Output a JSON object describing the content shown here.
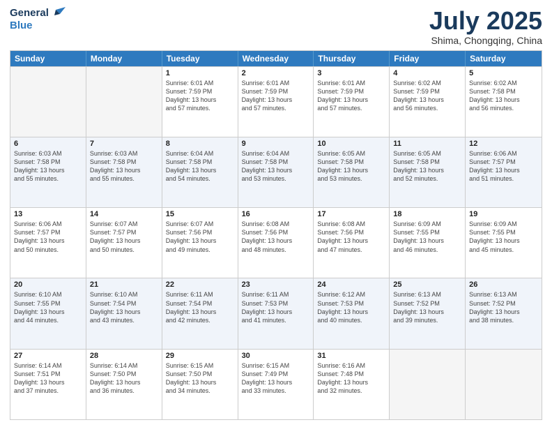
{
  "logo": {
    "line1": "General",
    "line2": "Blue"
  },
  "title": "July 2025",
  "subtitle": "Shima, Chongqing, China",
  "header_days": [
    "Sunday",
    "Monday",
    "Tuesday",
    "Wednesday",
    "Thursday",
    "Friday",
    "Saturday"
  ],
  "rows": [
    [
      {
        "day": "",
        "info": ""
      },
      {
        "day": "",
        "info": ""
      },
      {
        "day": "1",
        "info": "Sunrise: 6:01 AM\nSunset: 7:59 PM\nDaylight: 13 hours\nand 57 minutes."
      },
      {
        "day": "2",
        "info": "Sunrise: 6:01 AM\nSunset: 7:59 PM\nDaylight: 13 hours\nand 57 minutes."
      },
      {
        "day": "3",
        "info": "Sunrise: 6:01 AM\nSunset: 7:59 PM\nDaylight: 13 hours\nand 57 minutes."
      },
      {
        "day": "4",
        "info": "Sunrise: 6:02 AM\nSunset: 7:59 PM\nDaylight: 13 hours\nand 56 minutes."
      },
      {
        "day": "5",
        "info": "Sunrise: 6:02 AM\nSunset: 7:58 PM\nDaylight: 13 hours\nand 56 minutes."
      }
    ],
    [
      {
        "day": "6",
        "info": "Sunrise: 6:03 AM\nSunset: 7:58 PM\nDaylight: 13 hours\nand 55 minutes."
      },
      {
        "day": "7",
        "info": "Sunrise: 6:03 AM\nSunset: 7:58 PM\nDaylight: 13 hours\nand 55 minutes."
      },
      {
        "day": "8",
        "info": "Sunrise: 6:04 AM\nSunset: 7:58 PM\nDaylight: 13 hours\nand 54 minutes."
      },
      {
        "day": "9",
        "info": "Sunrise: 6:04 AM\nSunset: 7:58 PM\nDaylight: 13 hours\nand 53 minutes."
      },
      {
        "day": "10",
        "info": "Sunrise: 6:05 AM\nSunset: 7:58 PM\nDaylight: 13 hours\nand 53 minutes."
      },
      {
        "day": "11",
        "info": "Sunrise: 6:05 AM\nSunset: 7:58 PM\nDaylight: 13 hours\nand 52 minutes."
      },
      {
        "day": "12",
        "info": "Sunrise: 6:06 AM\nSunset: 7:57 PM\nDaylight: 13 hours\nand 51 minutes."
      }
    ],
    [
      {
        "day": "13",
        "info": "Sunrise: 6:06 AM\nSunset: 7:57 PM\nDaylight: 13 hours\nand 50 minutes."
      },
      {
        "day": "14",
        "info": "Sunrise: 6:07 AM\nSunset: 7:57 PM\nDaylight: 13 hours\nand 50 minutes."
      },
      {
        "day": "15",
        "info": "Sunrise: 6:07 AM\nSunset: 7:56 PM\nDaylight: 13 hours\nand 49 minutes."
      },
      {
        "day": "16",
        "info": "Sunrise: 6:08 AM\nSunset: 7:56 PM\nDaylight: 13 hours\nand 48 minutes."
      },
      {
        "day": "17",
        "info": "Sunrise: 6:08 AM\nSunset: 7:56 PM\nDaylight: 13 hours\nand 47 minutes."
      },
      {
        "day": "18",
        "info": "Sunrise: 6:09 AM\nSunset: 7:55 PM\nDaylight: 13 hours\nand 46 minutes."
      },
      {
        "day": "19",
        "info": "Sunrise: 6:09 AM\nSunset: 7:55 PM\nDaylight: 13 hours\nand 45 minutes."
      }
    ],
    [
      {
        "day": "20",
        "info": "Sunrise: 6:10 AM\nSunset: 7:55 PM\nDaylight: 13 hours\nand 44 minutes."
      },
      {
        "day": "21",
        "info": "Sunrise: 6:10 AM\nSunset: 7:54 PM\nDaylight: 13 hours\nand 43 minutes."
      },
      {
        "day": "22",
        "info": "Sunrise: 6:11 AM\nSunset: 7:54 PM\nDaylight: 13 hours\nand 42 minutes."
      },
      {
        "day": "23",
        "info": "Sunrise: 6:11 AM\nSunset: 7:53 PM\nDaylight: 13 hours\nand 41 minutes."
      },
      {
        "day": "24",
        "info": "Sunrise: 6:12 AM\nSunset: 7:53 PM\nDaylight: 13 hours\nand 40 minutes."
      },
      {
        "day": "25",
        "info": "Sunrise: 6:13 AM\nSunset: 7:52 PM\nDaylight: 13 hours\nand 39 minutes."
      },
      {
        "day": "26",
        "info": "Sunrise: 6:13 AM\nSunset: 7:52 PM\nDaylight: 13 hours\nand 38 minutes."
      }
    ],
    [
      {
        "day": "27",
        "info": "Sunrise: 6:14 AM\nSunset: 7:51 PM\nDaylight: 13 hours\nand 37 minutes."
      },
      {
        "day": "28",
        "info": "Sunrise: 6:14 AM\nSunset: 7:50 PM\nDaylight: 13 hours\nand 36 minutes."
      },
      {
        "day": "29",
        "info": "Sunrise: 6:15 AM\nSunset: 7:50 PM\nDaylight: 13 hours\nand 34 minutes."
      },
      {
        "day": "30",
        "info": "Sunrise: 6:15 AM\nSunset: 7:49 PM\nDaylight: 13 hours\nand 33 minutes."
      },
      {
        "day": "31",
        "info": "Sunrise: 6:16 AM\nSunset: 7:48 PM\nDaylight: 13 hours\nand 32 minutes."
      },
      {
        "day": "",
        "info": ""
      },
      {
        "day": "",
        "info": ""
      }
    ]
  ]
}
